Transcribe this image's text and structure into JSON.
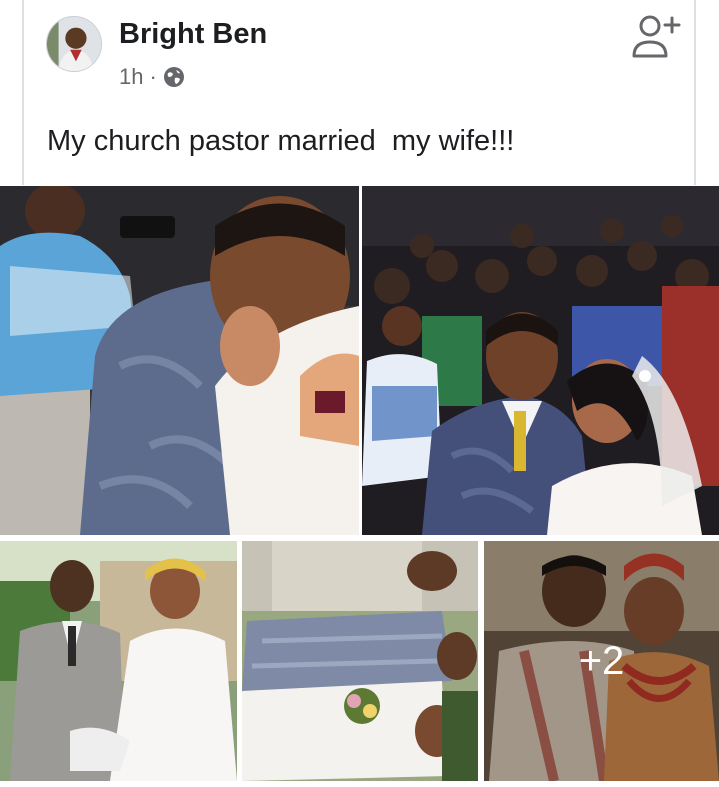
{
  "post": {
    "author": "Bright Ben",
    "time": "1h",
    "separator": "·",
    "privacy_icon": "globe-icon",
    "text": "My church pastor married  my wife!!!"
  },
  "header_action": {
    "icon": "add-friend-icon"
  },
  "photos": {
    "more_count_label": "+2"
  },
  "colors": {
    "text_primary": "#1c1e21",
    "text_secondary": "#65676b",
    "border": "#dcdfe4"
  }
}
